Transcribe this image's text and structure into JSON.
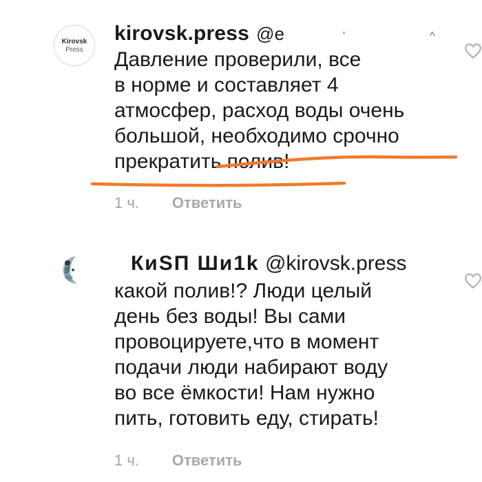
{
  "comments": [
    {
      "avatar_text_line1": "Kirovsk",
      "avatar_text_line2": "Press",
      "username": "kirovsk.press",
      "mention_fragment": "@e",
      "text": "Давление проверили, все\nв норме и составляет 4\nатмосфер, расход воды очень\nбольшой, необходимо срочно\nпрекратить полив!",
      "time": "1 ч.",
      "reply_label": "Ответить",
      "underline_color": "#f07a2a"
    },
    {
      "username_garbled": "КиSП    Ши1k",
      "mention": "@kirovsk.press",
      "text": "какой полив!? Люди целый\nдень без воды! Вы сами\nпровоцируете,что в момент\nподачи люди набирают воду\nво все ёмкости! Нам нужно\nпить, готовить еду, стирать!",
      "time": "1 ч.",
      "reply_label": "Ответить"
    }
  ],
  "colors": {
    "text": "#1a1a1a",
    "meta": "#a3a3a3",
    "highlight": "#f07a2a",
    "icon": "#b0b0b0"
  },
  "icons": [
    "heart-icon"
  ]
}
